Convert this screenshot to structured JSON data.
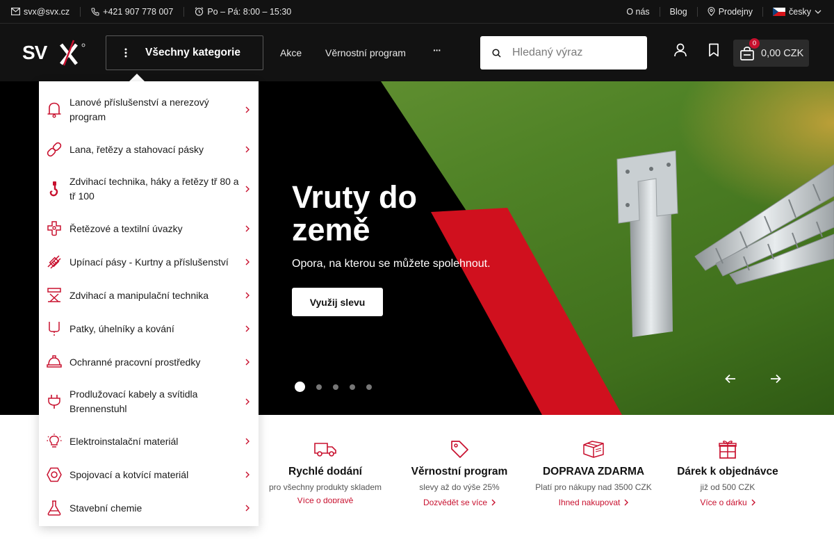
{
  "topbar": {
    "email": "svx@svx.cz",
    "phone": "+421 907 778 007",
    "hours": "Po – Pá: 8:00 – 15:30",
    "links": {
      "about": "O nás",
      "blog": "Blog",
      "stores": "Prodejny",
      "language": "česky"
    }
  },
  "header": {
    "logo": "SVX",
    "all_categories": "Všechny kategorie",
    "nav": {
      "sale": "Akce",
      "loyalty": "Věrnostní program",
      "more": "···"
    },
    "search_placeholder": "Hledaný výraz",
    "cart": {
      "count": "0",
      "total": "0,00 CZK"
    }
  },
  "menu": {
    "items": [
      {
        "label": "Lanové příslušenství a nerezový program",
        "icon": "bell-shackle-icon"
      },
      {
        "label": "Lana, řetězy a stahovací pásky",
        "icon": "chain-link-icon"
      },
      {
        "label": "Zdvihací technika, háky a řetězy tř 80 a tř 100",
        "icon": "hook-icon"
      },
      {
        "label": "Řetězové a textilní úvazky",
        "icon": "sling-icon"
      },
      {
        "label": "Upínací pásy - Kurtny a příslušenství",
        "icon": "strap-icon"
      },
      {
        "label": "Zdvihací a manipulační technika",
        "icon": "lifting-table-icon"
      },
      {
        "label": "Patky, úhelníky a kování",
        "icon": "bracket-icon"
      },
      {
        "label": "Ochranné pracovní prostředky",
        "icon": "hard-hat-icon"
      },
      {
        "label": "Prodlužovací kabely a svítidla Brennenstuhl",
        "icon": "plug-icon"
      },
      {
        "label": "Elektroinstalační materiál",
        "icon": "bulb-icon"
      },
      {
        "label": "Spojovací a kotvící materiál",
        "icon": "nut-icon"
      },
      {
        "label": "Stavební chemie",
        "icon": "flask-icon"
      }
    ]
  },
  "hero": {
    "title": "Vruty do země",
    "subtitle": "Opora, na kterou se můžete spolehnout.",
    "button": "Využij slevu"
  },
  "benefits": [
    {
      "title": "Rychlé dodání",
      "desc": "pro všechny produkty skladem",
      "link": "Více o dopravě"
    },
    {
      "title": "Věrnostní program",
      "desc": "slevy až do výše 25%",
      "link": "Dozvědět se více"
    },
    {
      "title": "DOPRAVA ZDARMA",
      "desc": "Platí pro nákupy nad 3500 CZK",
      "link": "Ihned nakupovat"
    },
    {
      "title": "Dárek k objednávce",
      "desc": "již od 500 CZK",
      "link": "Více o dárku"
    }
  ],
  "colors": {
    "accent": "#c8102e",
    "dark": "#121212"
  }
}
